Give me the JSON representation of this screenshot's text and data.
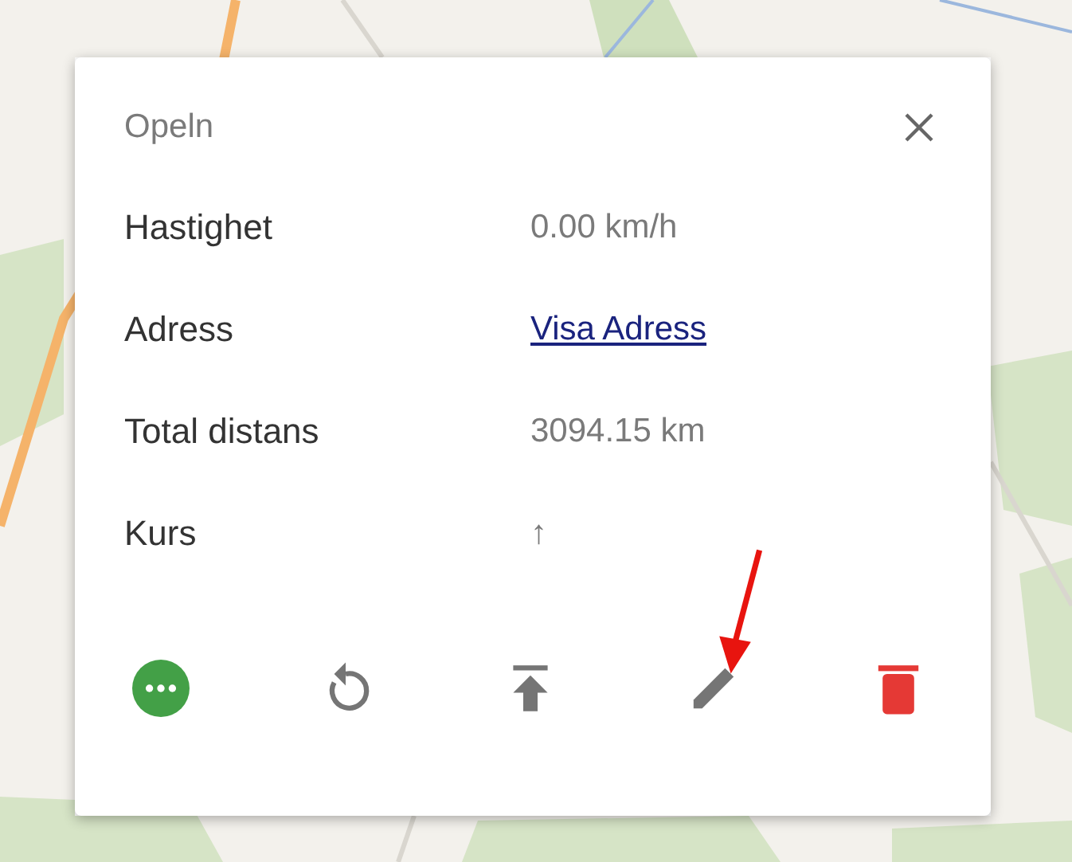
{
  "popup": {
    "title": "Opeln",
    "rows": [
      {
        "label": "Hastighet",
        "value": "0.00 km/h",
        "kind": "text"
      },
      {
        "label": "Adress",
        "value": "Visa Adress",
        "kind": "link"
      },
      {
        "label": "Total distans",
        "value": "3094.15 km",
        "kind": "text"
      },
      {
        "label": "Kurs",
        "value": "↑",
        "kind": "text"
      }
    ]
  }
}
